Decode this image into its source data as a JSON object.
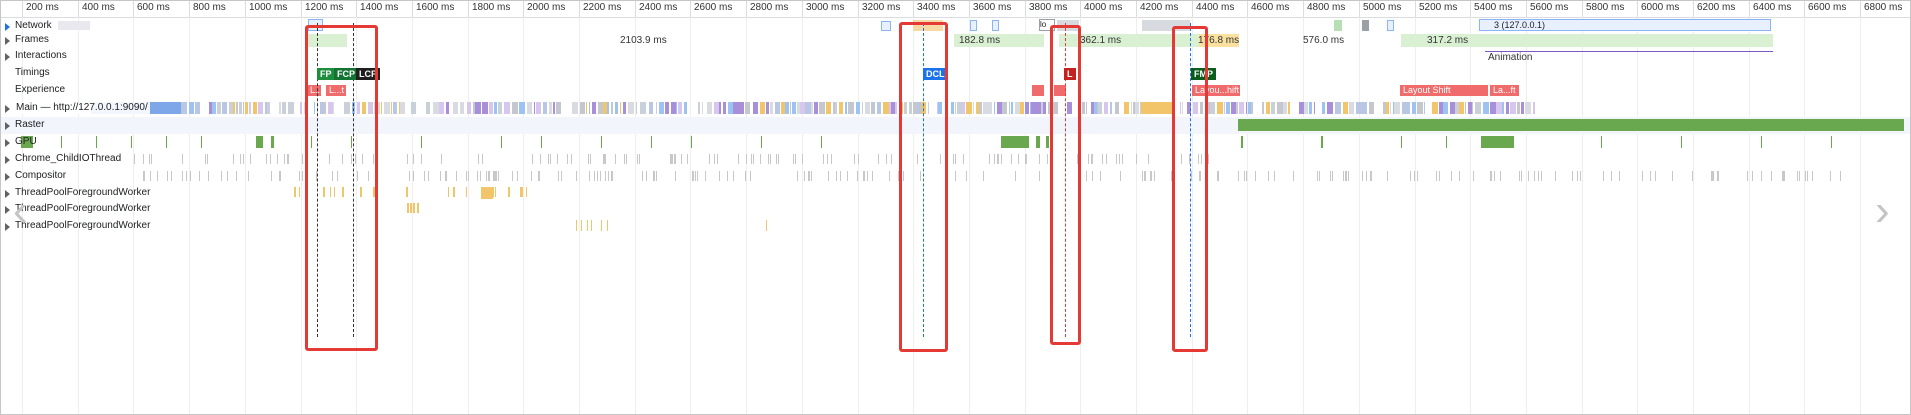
{
  "ruler": {
    "ticks": [
      "200 ms",
      "400 ms",
      "600 ms",
      "800 ms",
      "1000 ms",
      "1200 ms",
      "1400 ms",
      "1600 ms",
      "1800 ms",
      "2000 ms",
      "2200 ms",
      "2400 ms",
      "2600 ms",
      "2800 ms",
      "3000 ms",
      "3200 ms",
      "3400 ms",
      "3600 ms",
      "3800 ms",
      "4000 ms",
      "4200 ms",
      "4400 ms",
      "4600 ms",
      "4800 ms",
      "5000 ms",
      "5200 ms",
      "5400 ms",
      "5600 ms",
      "5800 ms",
      "6000 ms",
      "6200 ms",
      "6400 ms",
      "6600 ms",
      "6800 ms"
    ]
  },
  "tracks": {
    "network": "Network",
    "frames": "Frames",
    "interactions": "Interactions",
    "timings": "Timings",
    "experience": "Experience",
    "main": "Main — http://127.0.0.1:9090/",
    "raster": "Raster",
    "gpu": "GPU",
    "childio": "Chrome_ChildIOThread",
    "compositor": "Compositor",
    "worker1": "ThreadPoolForegroundWorker",
    "worker2": "ThreadPoolForegroundWorker",
    "worker3": "ThreadPoolForegroundWorker"
  },
  "network": {
    "request_label": "3 (127.0.0.1)",
    "small_label": "lo"
  },
  "frames": {
    "d1": "2103.9 ms",
    "d2": "182.8 ms",
    "d3": "362.1 ms",
    "d4": "176.8 ms",
    "d5": "576.0 ms",
    "d6": "317.2 ms"
  },
  "interactions": {
    "animation": "Animation"
  },
  "timings": {
    "fp": "FP",
    "fcp": "FCP",
    "lcp": "LCP",
    "dcl": "DCL",
    "l": "L",
    "fmp": "FMP"
  },
  "experience": {
    "s1": "L...",
    "s2": "L...t",
    "s3": "Layou...hift",
    "s4": "Layout Shift",
    "s5": "La...ft"
  },
  "colors": {
    "fp": "#1e8e3e",
    "fcp": "#137333",
    "lcp": "#1f1f1f",
    "dcl": "#1a73e8",
    "load": "#c5221f",
    "fmp": "#0b5d1e",
    "highlight": "#e53935",
    "shift": "#f06b6b"
  },
  "icons": {
    "expand": "triangle-right-icon",
    "prev": "chevron-left-icon",
    "next": "chevron-right-icon"
  }
}
